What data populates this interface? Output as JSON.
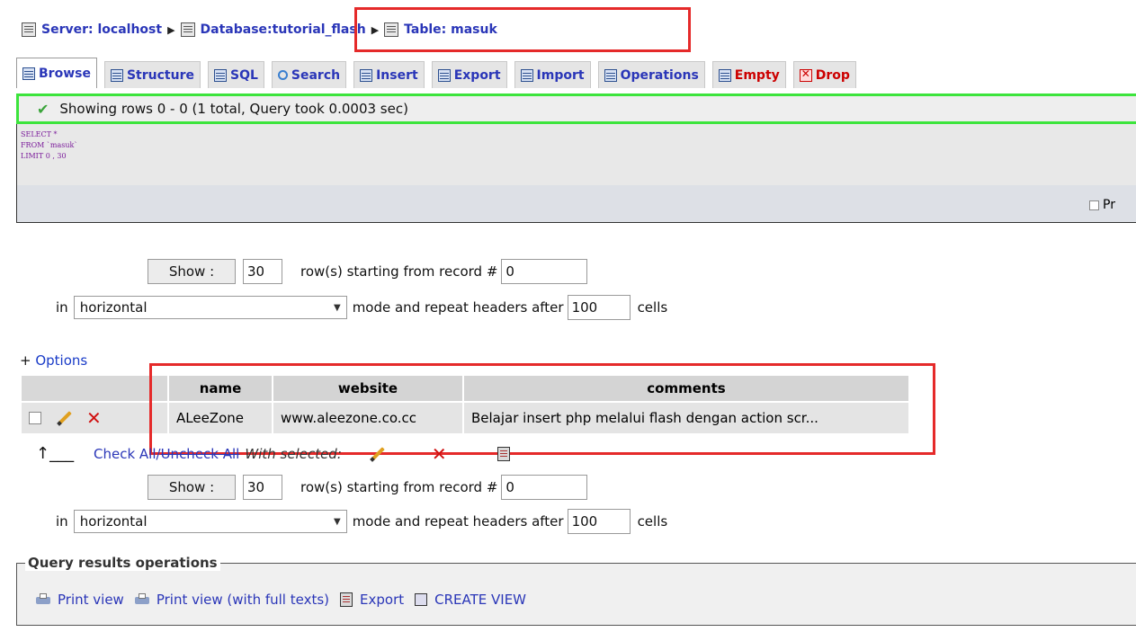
{
  "breadcrumb": {
    "server": "Server: localhost",
    "database_prefix": "Database: ",
    "database": "tutorial_flash",
    "table": "Table: masuk"
  },
  "tabs": [
    {
      "label": "Browse",
      "icon": "browse-icon",
      "active": true
    },
    {
      "label": "Structure",
      "icon": "structure-icon"
    },
    {
      "label": "SQL",
      "icon": "sql-icon"
    },
    {
      "label": "Search",
      "icon": "search-icon"
    },
    {
      "label": "Insert",
      "icon": "insert-icon"
    },
    {
      "label": "Export",
      "icon": "export-icon"
    },
    {
      "label": "Import",
      "icon": "import-icon"
    },
    {
      "label": "Operations",
      "icon": "operations-icon"
    },
    {
      "label": "Empty",
      "icon": "empty-icon",
      "color": "#cc0000"
    },
    {
      "label": "Drop",
      "icon": "drop-icon",
      "color": "#cc0000"
    }
  ],
  "notice": {
    "text": "Showing rows 0 - 0 (1 total, Query took 0.0003 sec)",
    "color": "#3ce43c"
  },
  "sql": {
    "line1": "SELECT *",
    "line2": "FROM `masuk`",
    "line3": "LIMIT 0 , 30",
    "profiling_label": "Pr"
  },
  "nav": {
    "show_label": "Show :",
    "rows_value": "30",
    "starting_label": "row(s) starting from record #",
    "start_value": "0",
    "in_label": "in",
    "mode_value": "horizontal",
    "mode_label": "mode and repeat headers after",
    "repeat_value": "100",
    "cells_label": "cells"
  },
  "options_link": {
    "plus": "+ ",
    "label": "Options"
  },
  "table": {
    "headers": [
      "name",
      "website",
      "comments"
    ],
    "rows": [
      {
        "name": "ALeeZone",
        "website": "www.aleezone.co.cc",
        "comments": "Belajar insert php melalui flash dengan action scr..."
      }
    ]
  },
  "bulk": {
    "check_all": "Check All",
    "separator": " / ",
    "uncheck_all": "Uncheck All",
    "with_selected": "With selected:"
  },
  "query_ops": {
    "legend": "Query results operations",
    "print_view": "Print view",
    "print_view_full": "Print view (with full texts)",
    "export": "Export",
    "create_view": "CREATE VIEW"
  },
  "colors": {
    "link": "#2a36b8",
    "highlight": "#e52a2a",
    "danger": "#cc0000"
  }
}
